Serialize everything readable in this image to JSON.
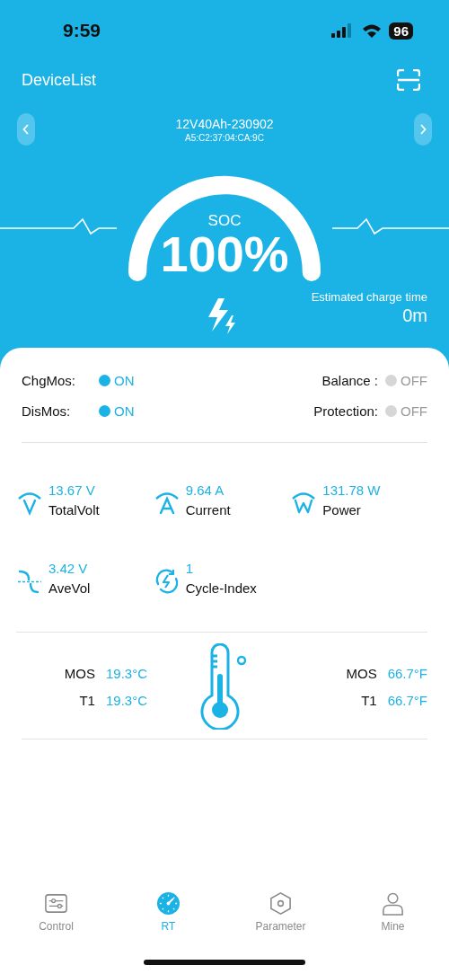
{
  "status_bar": {
    "time": "9:59",
    "battery": "96"
  },
  "header": {
    "title": "DeviceList"
  },
  "device": {
    "name": "12V40Ah-230902",
    "address": "A5:C2:37:04:CA:9C"
  },
  "gauge": {
    "label": "SOC",
    "value": "100%",
    "charging": true
  },
  "charge_time": {
    "label": "Estimated charge time",
    "value": "0m"
  },
  "switches": [
    {
      "label": "ChgMos:",
      "state": "ON",
      "on": true
    },
    {
      "label": "Balance :",
      "state": "OFF",
      "on": false
    },
    {
      "label": "DisMos:",
      "state": "ON",
      "on": true
    },
    {
      "label": "Protection:",
      "state": "OFF",
      "on": false
    }
  ],
  "metrics": [
    {
      "kind": "volt",
      "value": "13.67 V",
      "label": "TotalVolt"
    },
    {
      "kind": "amp",
      "value": "9.64 A",
      "label": "Current"
    },
    {
      "kind": "watt",
      "value": "131.78 W",
      "label": "Power"
    },
    {
      "kind": "avevol",
      "value": "3.42 V",
      "label": "AveVol"
    },
    {
      "kind": "cycle",
      "value": "1",
      "label": "Cycle-Index"
    }
  ],
  "temperatures_c": [
    {
      "label": "MOS",
      "value": "19.3°C"
    },
    {
      "label": "T1",
      "value": "19.3°C"
    }
  ],
  "temperatures_f": [
    {
      "label": "MOS",
      "value": "66.7°F"
    },
    {
      "label": "T1",
      "value": "66.7°F"
    }
  ],
  "tabs": [
    {
      "kind": "control",
      "label": "Control",
      "selected": false
    },
    {
      "kind": "rt",
      "label": "RT",
      "selected": true
    },
    {
      "kind": "parameter",
      "label": "Parameter",
      "selected": false
    },
    {
      "kind": "mine",
      "label": "Mine",
      "selected": false
    }
  ]
}
